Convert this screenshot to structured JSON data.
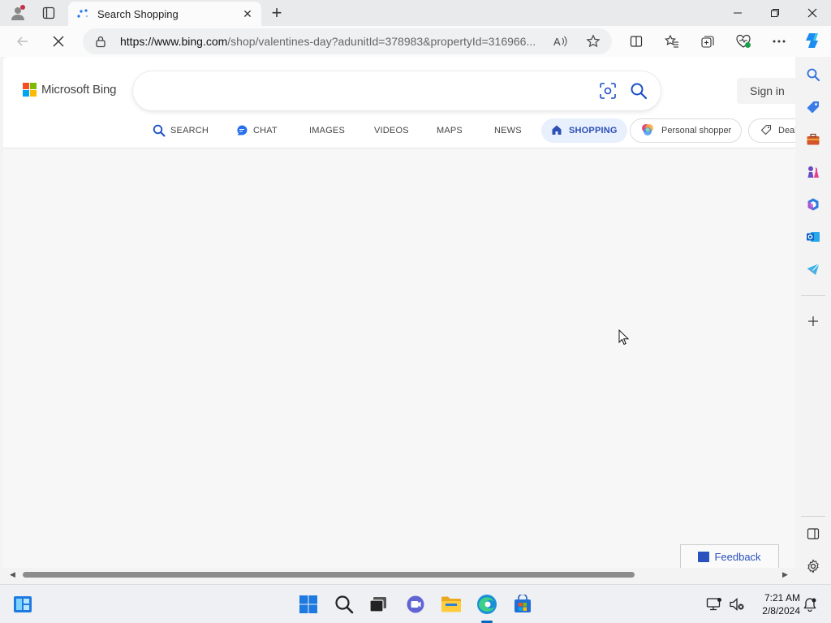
{
  "browser": {
    "tab_title": "Search Shopping",
    "url_host": "https://www.bing.com",
    "url_rest": "/shop/valentines-day?adunitId=378983&propertyId=316966..."
  },
  "bing": {
    "brand": "Microsoft Bing",
    "search_value": "",
    "signin_label": "Sign in",
    "scopes": [
      {
        "label": "SEARCH",
        "icon": "search-icon"
      },
      {
        "label": "CHAT",
        "icon": "chat-icon"
      },
      {
        "label": "IMAGES"
      },
      {
        "label": "VIDEOS"
      },
      {
        "label": "MAPS"
      },
      {
        "label": "NEWS"
      },
      {
        "label": "SHOPPING",
        "icon": "home-icon",
        "active": true
      }
    ],
    "pills": [
      {
        "label": "Personal shopper",
        "icon": "copilot-icon"
      },
      {
        "label": "Deals",
        "icon": "tag-icon"
      }
    ],
    "feedback_label": "Feedback"
  },
  "taskbar": {
    "time": "7:21 AM",
    "date": "2/8/2024"
  },
  "colors": {
    "accent": "#0067c0",
    "shopping_active": "#2c4fb6",
    "feedback": "#2a52be"
  }
}
